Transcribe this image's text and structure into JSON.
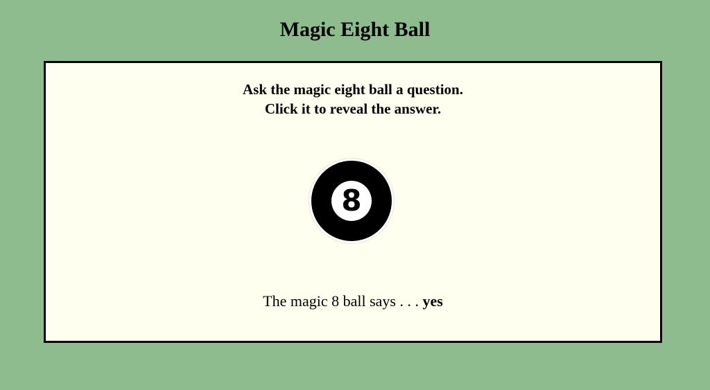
{
  "page": {
    "title": "Magic Eight Ball",
    "background_color": "#8fbc8f",
    "panel_color": "#fffff0"
  },
  "instructions": {
    "line1": "Ask the magic eight ball a question.",
    "line2": "Click it to reveal the answer."
  },
  "ball": {
    "number": "8",
    "icon": "eight-ball-icon"
  },
  "answer": {
    "prefix": "The magic 8 ball says . . .",
    "value": "yes"
  }
}
